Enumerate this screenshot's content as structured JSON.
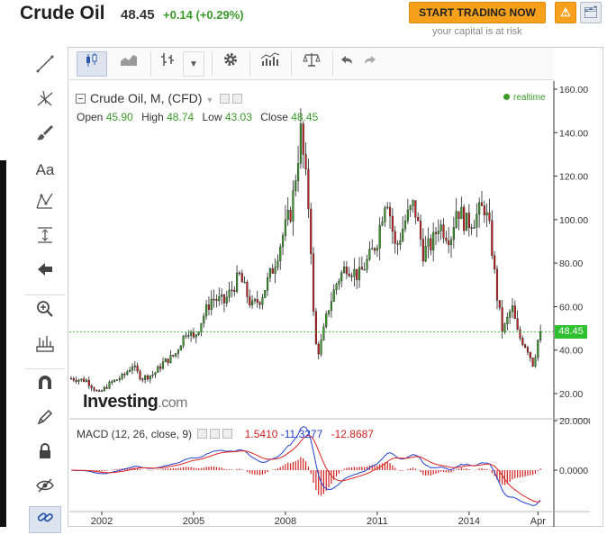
{
  "header": {
    "title": "Crude Oil",
    "price": "48.45",
    "change": "+0.14 (+0.29%)",
    "trade_button": "START TRADING NOW",
    "risk_note": "your capital is at risk",
    "alert_icon": "bell-plus-icon",
    "portfolio_icon": "portfolio-add-icon"
  },
  "chart": {
    "instrument": "Crude Oil, M, (CFD)",
    "ohlc": {
      "open_label": "Open",
      "open": "45.90",
      "high_label": "High",
      "high": "48.74",
      "low_label": "Low",
      "low": "43.03",
      "close_label": "Close",
      "close": "48.45"
    },
    "realtime": "realtime",
    "last_price_tag": "48.45",
    "logo_main": "Investing",
    "logo_suffix": ".com",
    "macd": {
      "label": "MACD (12, 26, close, 9)",
      "v1": "1.5410",
      "v2": "-11.3277",
      "v3": "-12.8687"
    },
    "colors": {
      "up": "#3a9a2a",
      "down": "#c81e1e",
      "macd_line": "#2040d0",
      "signal_line": "#e02020"
    }
  },
  "side_tools": [
    "trend-line-icon",
    "fork-icon",
    "brush-icon",
    "text-tool-icon",
    "pattern-icon",
    "measure-icon",
    "back-arrow-icon",
    "zoom-icon",
    "ruler-icon",
    "magnet-icon",
    "pencil-lock-icon",
    "lock-icon",
    "eye-icon",
    "link-icon"
  ],
  "side_text_tool": "Aa",
  "chart_data": {
    "type": "candlestick",
    "x_ticks": [
      "2002",
      "2005",
      "2008",
      "2011",
      "2014",
      "Apr"
    ],
    "y_ticks": [
      "160.00",
      "140.00",
      "120.00",
      "100.00",
      "80.00",
      "60.00",
      "40.00",
      "20.00"
    ],
    "ylim": [
      10,
      162
    ],
    "macd_ticks": [
      "20.0000",
      "0.0000"
    ],
    "start_year": 2001.0,
    "end_year": 2016.3,
    "close_series": [
      [
        2001.0,
        27
      ],
      [
        2001.5,
        26
      ],
      [
        2001.9,
        20
      ],
      [
        2002.3,
        25
      ],
      [
        2002.7,
        28
      ],
      [
        2003.0,
        33
      ],
      [
        2003.3,
        27
      ],
      [
        2003.7,
        29
      ],
      [
        2004.0,
        34
      ],
      [
        2004.4,
        38
      ],
      [
        2004.8,
        50
      ],
      [
        2005.0,
        45
      ],
      [
        2005.3,
        55
      ],
      [
        2005.6,
        64
      ],
      [
        2006.0,
        62
      ],
      [
        2006.5,
        74
      ],
      [
        2006.9,
        60
      ],
      [
        2007.2,
        64
      ],
      [
        2007.6,
        78
      ],
      [
        2007.9,
        92
      ],
      [
        2008.2,
        105
      ],
      [
        2008.5,
        140
      ],
      [
        2008.8,
        100
      ],
      [
        2008.95,
        44
      ],
      [
        2009.1,
        39
      ],
      [
        2009.4,
        59
      ],
      [
        2009.7,
        72
      ],
      [
        2010.0,
        79
      ],
      [
        2010.4,
        74
      ],
      [
        2010.8,
        84
      ],
      [
        2011.0,
        91
      ],
      [
        2011.3,
        113
      ],
      [
        2011.6,
        86
      ],
      [
        2011.9,
        99
      ],
      [
        2012.2,
        107
      ],
      [
        2012.5,
        85
      ],
      [
        2012.8,
        89
      ],
      [
        2013.0,
        98
      ],
      [
        2013.4,
        92
      ],
      [
        2013.6,
        106
      ],
      [
        2013.9,
        98
      ],
      [
        2014.2,
        101
      ],
      [
        2014.5,
        106
      ],
      [
        2014.7,
        93
      ],
      [
        2014.9,
        66
      ],
      [
        2015.1,
        48
      ],
      [
        2015.4,
        60
      ],
      [
        2015.6,
        47
      ],
      [
        2015.9,
        41
      ],
      [
        2016.1,
        33
      ],
      [
        2016.3,
        48.45
      ]
    ]
  }
}
